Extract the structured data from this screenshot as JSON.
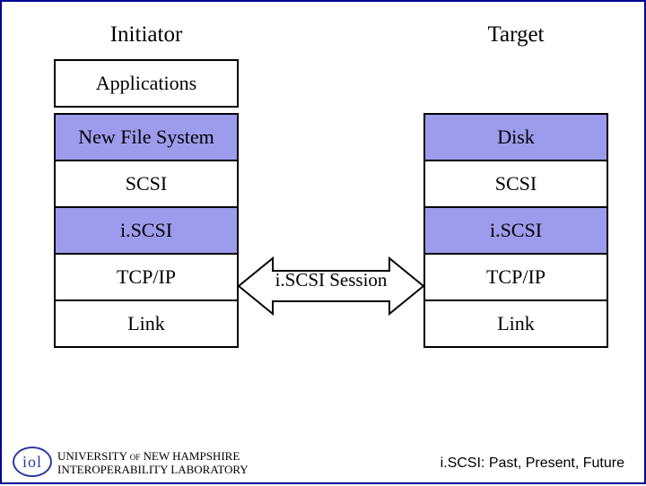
{
  "diagram": {
    "accent_color": "#9d9bec",
    "border_color": "#000093",
    "initiator": {
      "title": "Initiator",
      "layers": [
        {
          "label": "Applications",
          "filled": false
        },
        {
          "label": "New File System",
          "filled": true
        },
        {
          "label": "SCSI",
          "filled": false
        },
        {
          "label": "i.SCSI",
          "filled": true
        },
        {
          "label": "TCP/IP",
          "filled": false
        },
        {
          "label": "Link",
          "filled": false
        }
      ]
    },
    "target": {
      "title": "Target",
      "layers": [
        {
          "label": "Disk",
          "filled": true
        },
        {
          "label": "SCSI",
          "filled": false
        },
        {
          "label": "i.SCSI",
          "filled": true
        },
        {
          "label": "TCP/IP",
          "filled": false
        },
        {
          "label": "Link",
          "filled": false
        }
      ]
    },
    "arrow_label": "i.SCSI Session"
  },
  "footer": {
    "logo_text": "iol",
    "org_line1": "UNIVERSITY of NEW HAMPSHIRE",
    "org_line2": "INTEROPERABILITY LABORATORY",
    "right_text": "i.SCSI: Past, Present, Future"
  }
}
